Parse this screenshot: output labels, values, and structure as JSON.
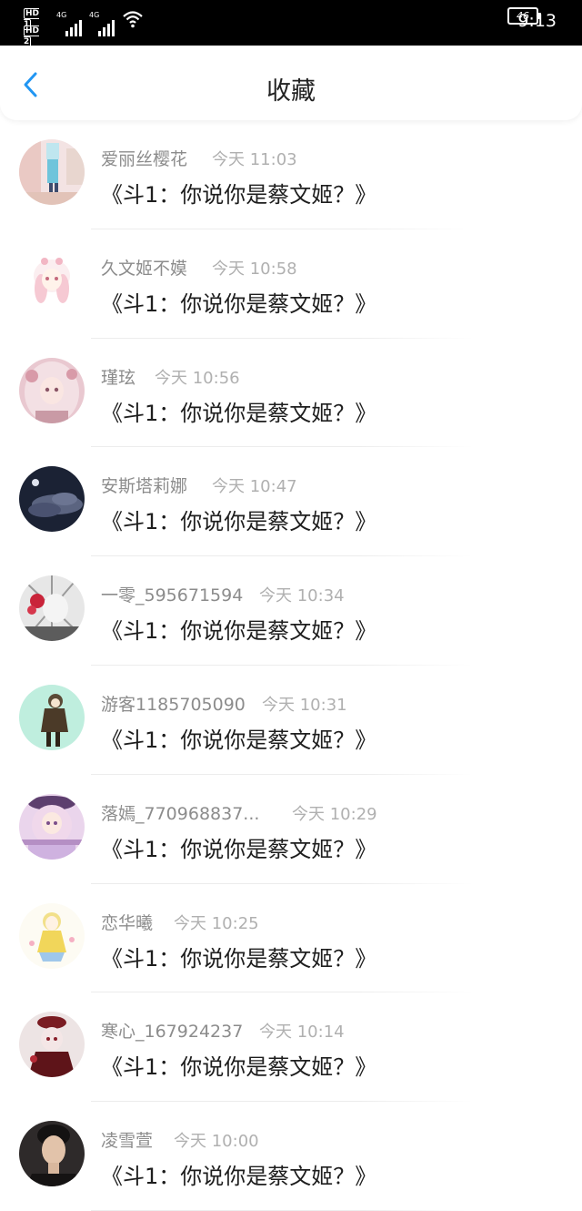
{
  "status_bar": {
    "sim1_label": "HD 1",
    "sim2_label": "HD 2",
    "network1": "4G",
    "network2": "4G",
    "battery": "46",
    "time": "9:13"
  },
  "header": {
    "title": "收藏",
    "back_icon": "chevron-left-icon",
    "accent_color": "#2196f3"
  },
  "items": [
    {
      "name": "爱丽丝樱花",
      "time": "今天 11:03",
      "message": "《斗1：你说你是蔡文姬？》"
    },
    {
      "name": "久文姬不嫫",
      "time": "今天 10:58",
      "message": "《斗1：你说你是蔡文姬？》"
    },
    {
      "name": "瑾玹",
      "time": "今天 10:56",
      "message": "《斗1：你说你是蔡文姬？》"
    },
    {
      "name": "安斯塔莉娜",
      "time": "今天 10:47",
      "message": "《斗1：你说你是蔡文姬？》"
    },
    {
      "name": "一零_595671594",
      "time": "今天 10:34",
      "message": "《斗1：你说你是蔡文姬？》"
    },
    {
      "name": "游客1185705090",
      "time": "今天 10:31",
      "message": "《斗1：你说你是蔡文姬？》"
    },
    {
      "name": "落嫣_770968837...",
      "time": "今天 10:29",
      "message": "《斗1：你说你是蔡文姬？》"
    },
    {
      "name": "恋华曦",
      "time": "今天 10:25",
      "message": "《斗1：你说你是蔡文姬？》"
    },
    {
      "name": "寒心_167924237",
      "time": "今天 10:14",
      "message": "《斗1：你说你是蔡文姬？》"
    },
    {
      "name": "凌雪萱",
      "time": "今天 10:00",
      "message": "《斗1：你说你是蔡文姬？》"
    }
  ]
}
